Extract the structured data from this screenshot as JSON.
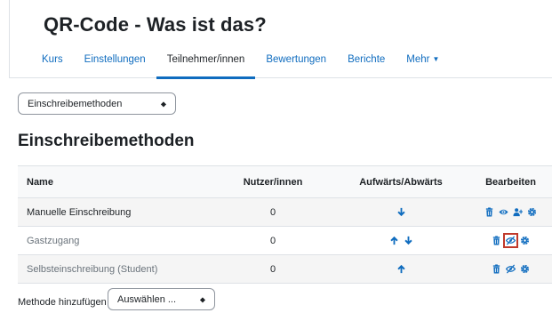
{
  "course": {
    "title": "QR-Code - Was ist das?"
  },
  "nav": {
    "items": [
      "Kurs",
      "Einstellungen",
      "Teilnehmer/innen",
      "Bewertungen",
      "Berichte",
      "Mehr"
    ],
    "active_index": 2
  },
  "method_select": {
    "value": "Einschreibemethoden"
  },
  "page": {
    "heading": "Einschreibemethoden"
  },
  "table": {
    "headers": {
      "name": "Name",
      "users": "Nutzer/innen",
      "move": "Aufwärts/Abwärts",
      "edit": "Bearbeiten"
    },
    "rows": [
      {
        "name": "Manuelle Einschreibung",
        "users": "0",
        "move": [
          "down"
        ],
        "edit": [
          "delete",
          "visible",
          "enrol-users",
          "settings"
        ]
      },
      {
        "name": "Gastzugang",
        "users": "0",
        "move": [
          "up",
          "down"
        ],
        "edit": [
          "delete",
          "hidden",
          "settings"
        ],
        "highlighted_edit": "hidden"
      },
      {
        "name": "Selbsteinschreibung (Student)",
        "users": "0",
        "move": [
          "up"
        ],
        "edit": [
          "delete",
          "hidden",
          "settings"
        ]
      }
    ]
  },
  "add_method": {
    "label": "Methode hinzufügen",
    "value": "Auswählen ..."
  },
  "colors": {
    "link": "#0f6cbf",
    "highlight_box": "#c0392b"
  }
}
